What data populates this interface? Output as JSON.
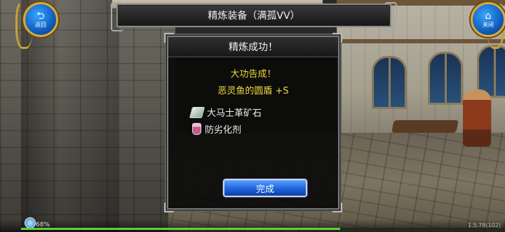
{
  "header": {
    "title": "精炼装备（满孤VV）"
  },
  "nav": {
    "back_label": "返回",
    "back_icon": "back-arrow-icon",
    "close_label": "关闭",
    "close_icon": "home-icon"
  },
  "dialog": {
    "title": "精炼成功！",
    "success_text": "大功告成！",
    "item_text": "恶灵鱼的圆盾 +S",
    "materials": [
      {
        "name": "大马士革矿石",
        "icon": "ore-icon"
      },
      {
        "name": "防劣化剂",
        "icon": "potion-icon"
      }
    ],
    "confirm_label": "完成"
  },
  "status": {
    "battery_text": "68%",
    "version_text": "1.5.78(102)",
    "progress": 0.66
  },
  "colors": {
    "highlight_text": "#f3dc3c",
    "button_blue": "#1f63dc",
    "progress_green": "#5fd13b"
  }
}
